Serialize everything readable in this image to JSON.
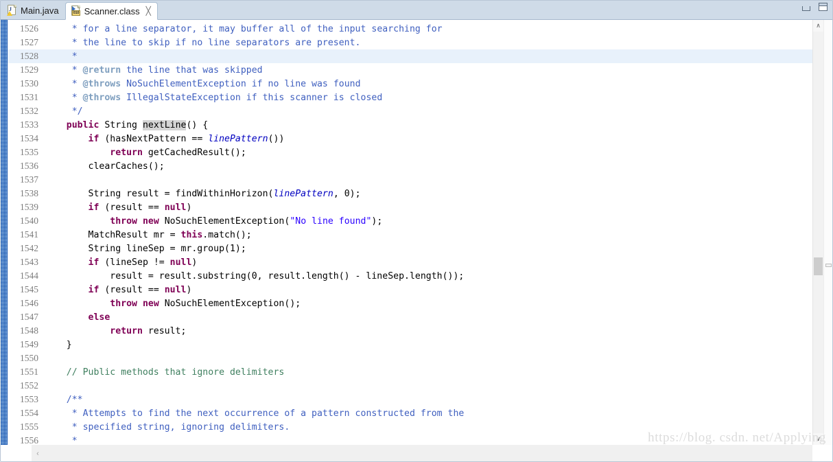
{
  "window": {
    "minimize_label": "Minimize",
    "maximize_label": "Maximize"
  },
  "tabs": [
    {
      "label": "Main.java",
      "icon": "java-file-icon",
      "active": false,
      "closable": false
    },
    {
      "label": "Scanner.class",
      "icon": "class-file-icon",
      "active": true,
      "closable": true,
      "close_glyph": "╳"
    }
  ],
  "editor": {
    "first_line_number": 1526,
    "highlighted_line": 1528,
    "occurrence_highlight_token": "nextLine",
    "colors": {
      "keyword": "#7F0055",
      "string": "#2A00FF",
      "line_comment": "#3F7F5F",
      "javadoc": "#3F5FBF",
      "javadoc_tag": "#7F9FBF",
      "field_italic": "#0000C0",
      "line_number": "#7C7C7C",
      "current_line_highlight": "#E8F1FB",
      "occurrence_highlight": "#D4D4D4",
      "tab_bar_background": "#CFDBE8",
      "change_ruler_blue": "#1F6FC4"
    },
    "lines": [
      {
        "n": 1526,
        "html": "     <span class=\"jdoc\">* for a line separator, it may buffer all of the input searching for</span>"
      },
      {
        "n": 1527,
        "html": "     <span class=\"jdoc\">* the line to skip if no line separators are present.</span>"
      },
      {
        "n": 1528,
        "html": "     <span class=\"jdoc\">*</span>"
      },
      {
        "n": 1529,
        "html": "     <span class=\"jdoc\">* <span class=\"jtag\">@return</span> the line that was skipped</span>"
      },
      {
        "n": 1530,
        "html": "     <span class=\"jdoc\">* <span class=\"jtag\">@throws</span> NoSuchElementException if no line was found</span>"
      },
      {
        "n": 1531,
        "html": "     <span class=\"jdoc\">* <span class=\"jtag\">@throws</span> IllegalStateException if this scanner is closed</span>"
      },
      {
        "n": 1532,
        "html": "     <span class=\"jdoc\">*/</span>"
      },
      {
        "n": 1533,
        "html": "    <span class=\"kw\">public</span> String <span class=\"occ\">nextLine</span>() {"
      },
      {
        "n": 1534,
        "html": "        <span class=\"kw\">if</span> (hasNextPattern == <span class=\"fld\">linePattern</span>())"
      },
      {
        "n": 1535,
        "html": "            <span class=\"kw\">return</span> getCachedResult();"
      },
      {
        "n": 1536,
        "html": "        clearCaches();"
      },
      {
        "n": 1537,
        "html": ""
      },
      {
        "n": 1538,
        "html": "        String result = findWithinHorizon(<span class=\"fld\">linePattern</span>, 0);"
      },
      {
        "n": 1539,
        "html": "        <span class=\"kw\">if</span> (result == <span class=\"kw\">null</span>)"
      },
      {
        "n": 1540,
        "html": "            <span class=\"kw\">throw</span> <span class=\"kw\">new</span> NoSuchElementException(<span class=\"str\">\"No line found\"</span>);"
      },
      {
        "n": 1541,
        "html": "        MatchResult mr = <span class=\"kw\">this</span>.match();"
      },
      {
        "n": 1542,
        "html": "        String lineSep = mr.group(1);"
      },
      {
        "n": 1543,
        "html": "        <span class=\"kw\">if</span> (lineSep != <span class=\"kw\">null</span>)"
      },
      {
        "n": 1544,
        "html": "            result = result.substring(0, result.length() - lineSep.length());"
      },
      {
        "n": 1545,
        "html": "        <span class=\"kw\">if</span> (result == <span class=\"kw\">null</span>)"
      },
      {
        "n": 1546,
        "html": "            <span class=\"kw\">throw</span> <span class=\"kw\">new</span> NoSuchElementException();"
      },
      {
        "n": 1547,
        "html": "        <span class=\"kw\">else</span>"
      },
      {
        "n": 1548,
        "html": "            <span class=\"kw\">return</span> result;"
      },
      {
        "n": 1549,
        "html": "    }"
      },
      {
        "n": 1550,
        "html": ""
      },
      {
        "n": 1551,
        "html": "    <span class=\"cmt\">// Public methods that ignore delimiters</span>"
      },
      {
        "n": 1552,
        "html": ""
      },
      {
        "n": 1553,
        "html": "    <span class=\"jdoc\">/**</span>"
      },
      {
        "n": 1554,
        "html": "     <span class=\"jdoc\">* Attempts to find the next occurrence of a pattern constructed from the</span>"
      },
      {
        "n": 1555,
        "html": "     <span class=\"jdoc\">* specified string, ignoring delimiters.</span>"
      },
      {
        "n": 1556,
        "html": "     <span class=\"jdoc\">*</span>"
      }
    ],
    "plain_lines": [
      "     * for a line separator, it may buffer all of the input searching for",
      "     * the line to skip if no line separators are present.",
      "     *",
      "     * @return the line that was skipped",
      "     * @throws NoSuchElementException if no line was found",
      "     * @throws IllegalStateException if this scanner is closed",
      "     */",
      "    public String nextLine() {",
      "        if (hasNextPattern == linePattern())",
      "            return getCachedResult();",
      "        clearCaches();",
      "",
      "        String result = findWithinHorizon(linePattern, 0);",
      "        if (result == null)",
      "            throw new NoSuchElementException(\"No line found\");",
      "        MatchResult mr = this.match();",
      "        String lineSep = mr.group(1);",
      "        if (lineSep != null)",
      "            result = result.substring(0, result.length() - lineSep.length());",
      "        if (result == null)",
      "            throw new NoSuchElementException();",
      "        else",
      "            return result;",
      "    }",
      "",
      "    // Public methods that ignore delimiters",
      "",
      "    /**",
      "     * Attempts to find the next occurrence of a pattern constructed from the",
      "     * specified string, ignoring delimiters.",
      "     *"
    ]
  },
  "scrollbars": {
    "vertical": {
      "up_glyph": "∧",
      "down_glyph": "∨"
    },
    "horizontal": {
      "left_glyph": "‹"
    }
  },
  "watermark": "https://blog. csdn. net/Applying"
}
